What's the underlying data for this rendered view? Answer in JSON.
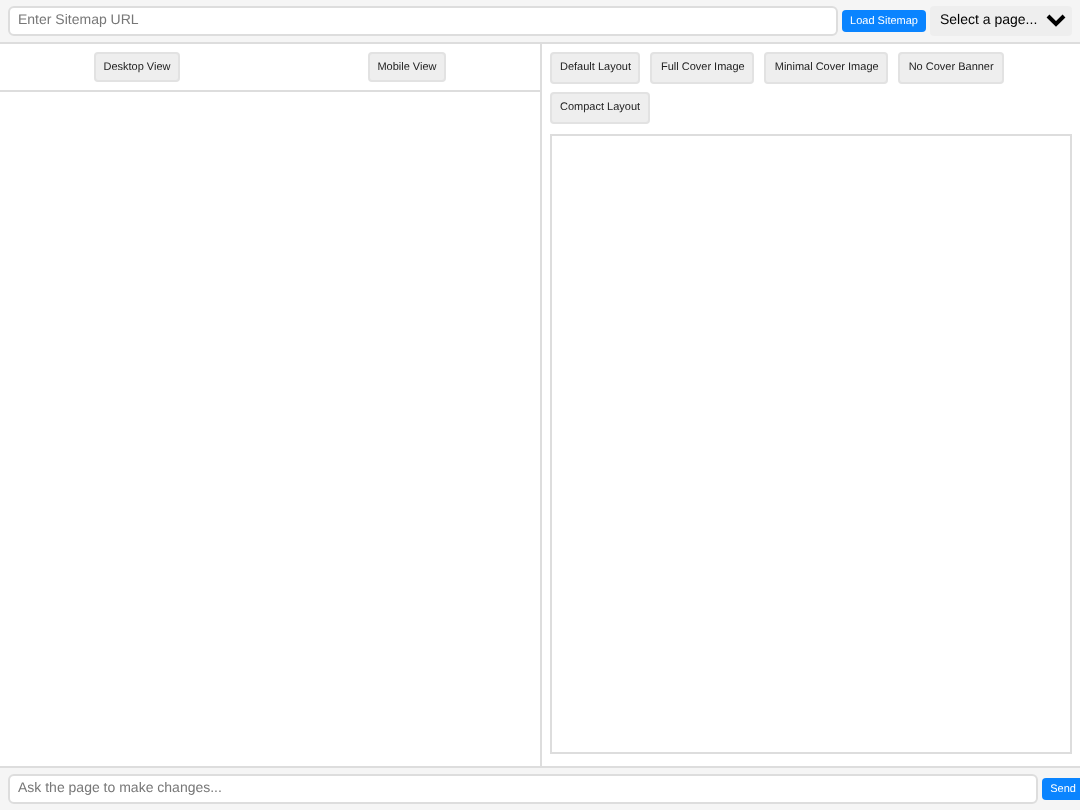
{
  "top_bar": {
    "url_field": {
      "placeholder": "Enter Sitemap URL"
    },
    "load_button": "Load Sitemap",
    "page_select": "Select a page..."
  },
  "view_buttons": [
    "Desktop View",
    "Mobile View"
  ],
  "layout_buttons": [
    "Default Layout",
    "Full Cover Image",
    "Minimal Cover Image",
    "No Cover Banner",
    "Compact Layout"
  ],
  "chat_bar": {
    "input": {
      "placeholder": "Ask the page to make changes..."
    },
    "send_button": "Send"
  }
}
